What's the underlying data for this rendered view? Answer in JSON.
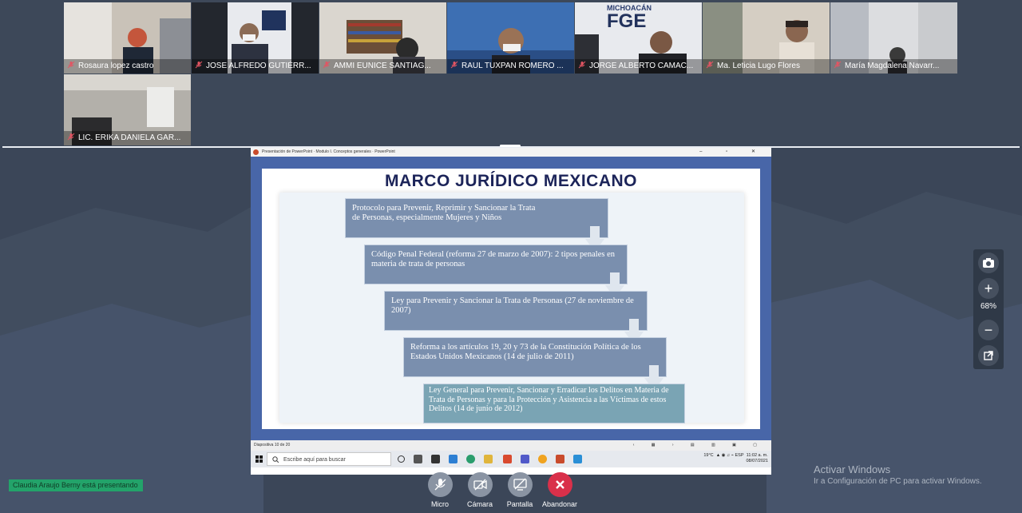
{
  "participants": [
    {
      "name": "Rosaura lopez castro",
      "scene_color": "#c9c2b8"
    },
    {
      "name": "JOSE ALFREDO GUTIÉRR...",
      "scene_color": "#2a2e36"
    },
    {
      "name": "AMMI EUNICE SANTIAG...",
      "scene_color": "#d9d5cc"
    },
    {
      "name": "RAUL TUXPAN ROMERO ...",
      "scene_color": "#3e6fb2"
    },
    {
      "name": "JORGE ALBERTO CAMAC...",
      "scene_color": "#e7e9ee"
    },
    {
      "name": "Ma. Leticia Lugo Flores",
      "scene_color": "#d6cfc4"
    },
    {
      "name": "María Magdalena Navarr...",
      "scene_color": "#dcdde0"
    },
    {
      "name": "LIC. ERIKA DANIELA GAR...",
      "scene_color": "#b4b1ab"
    }
  ],
  "fge_label": "FGE",
  "fge_top": "MICHOACÁN",
  "powerpoint": {
    "window_title": "Presentación de PowerPoint  ·  Modulo I. Conceptos generales · PowerPoint",
    "slide_counter": "Diapositiva 10 de 20",
    "slide_title": "MARCO JURÍDICO MEXICANO",
    "steps": [
      "Protocolo para Prevenir, Reprimir y Sancionar la Trata\n        de Personas, especialmente Mujeres y Niños",
      "Código Penal Federal (reforma 27 de marzo de 2007): 2 tipos penales en materia de trata de personas",
      "Ley para Prevenir y Sancionar la Trata de Personas (27 de noviembre de 2007)",
      "Reforma a los artículos 19, 20 y 73 de la Constitución Política de los Estados Unidos Mexicanos (14 de julio de 2011)",
      "Ley General para Prevenir, Sancionar y Erradicar los Delitos en Materia de Trata de Personas y para la Protección y Asistencia a las Víctimas de estos Delitos (14 de junio de 2012)"
    ]
  },
  "taskbar": {
    "search_placeholder": "Escribe aquí para buscar",
    "weather": "19°C",
    "lang": "ESP",
    "time": "11:02 a. m.",
    "date": "08/07/2021"
  },
  "zoom": {
    "value": "68%"
  },
  "presenting_text": "Claudia Araujo Berny está presentando",
  "controls": {
    "mic": "Micro",
    "camera": "Cámara",
    "screen": "Pantalla",
    "leave": "Abandonar"
  },
  "activation": {
    "title": "Activar Windows",
    "subtitle": "Ir a Configuración de PC para activar Windows."
  },
  "colors": {
    "leave": "#d9304a",
    "slide_border": "#4866a8",
    "step": "#7a8fae",
    "step_last": "#7aa4b4"
  }
}
